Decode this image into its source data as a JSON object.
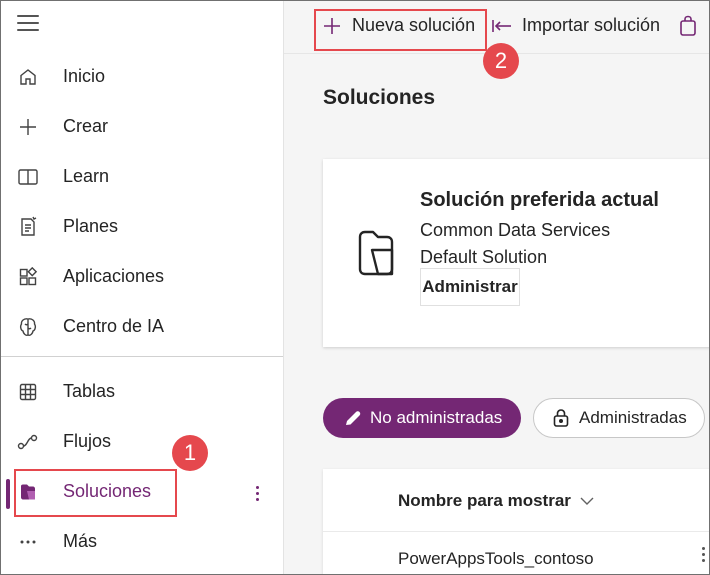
{
  "sidebar": {
    "items": [
      {
        "label": "Inicio",
        "icon": "home-icon"
      },
      {
        "label": "Crear",
        "icon": "plus-icon"
      },
      {
        "label": "Learn",
        "icon": "book-icon"
      },
      {
        "label": "Planes",
        "icon": "plan-icon"
      },
      {
        "label": "Aplicaciones",
        "icon": "apps-icon"
      },
      {
        "label": "Centro de IA",
        "icon": "brain-icon"
      },
      {
        "label": "Tablas",
        "icon": "table-icon"
      },
      {
        "label": "Flujos",
        "icon": "flow-icon"
      },
      {
        "label": "Soluciones",
        "icon": "solutions-icon"
      },
      {
        "label": "Más",
        "icon": "more-icon"
      }
    ],
    "active": "Soluciones",
    "accent": "#742774"
  },
  "commands": {
    "new_solution": "Nueva solución",
    "import_solution": "Importar solución"
  },
  "callouts": {
    "one": "1",
    "two": "2",
    "color": "#e5484d"
  },
  "page": {
    "title": "Soluciones"
  },
  "preferred": {
    "title": "Solución preferida actual",
    "subtitle": "Common Data Services Default Solution",
    "manage": "Administrar"
  },
  "filters": {
    "unmanaged": "No administradas",
    "managed": "Administradas"
  },
  "table": {
    "column": "Nombre para mostrar",
    "rows": [
      "PowerAppsTools_contoso"
    ]
  }
}
